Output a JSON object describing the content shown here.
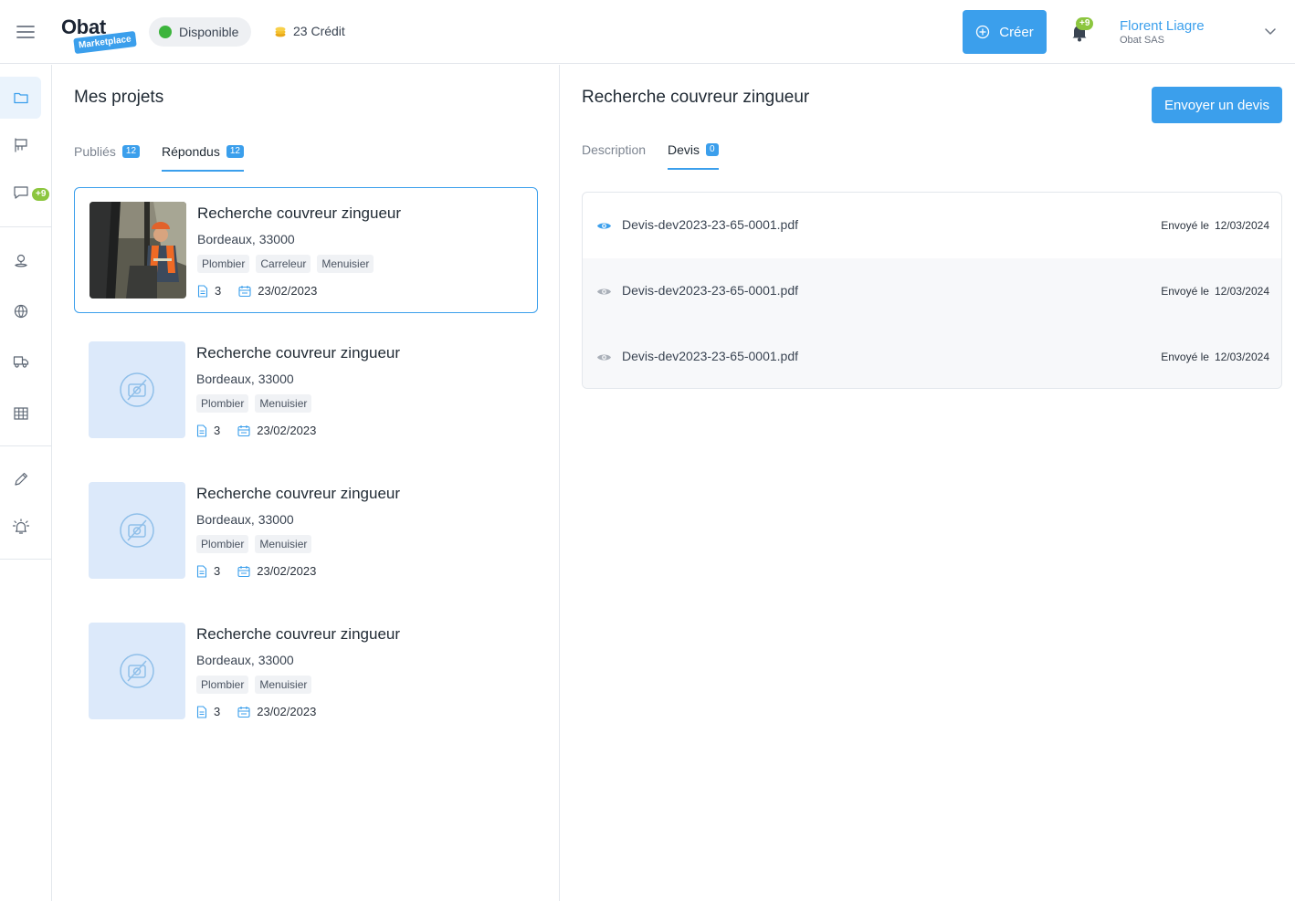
{
  "header": {
    "logo_text": "Obat",
    "logo_badge": "Marketplace",
    "status_label": "Disponible",
    "credit_label": "23 Crédit",
    "create_label": "Créer",
    "notification_badge": "+9",
    "user_name": "Florent Liagre",
    "user_company": "Obat SAS"
  },
  "sidebar": {
    "messages_badge": "+9",
    "items": [
      {
        "icon": "folder-icon"
      },
      {
        "icon": "flag-icon"
      },
      {
        "icon": "chat-icon"
      },
      {
        "icon": "map-pin-icon"
      },
      {
        "icon": "globe-icon"
      },
      {
        "icon": "truck-icon"
      },
      {
        "icon": "grid-table-icon"
      },
      {
        "icon": "pencil-icon"
      },
      {
        "icon": "alarm-bell-icon"
      }
    ]
  },
  "projects": {
    "title": "Mes projets",
    "tabs": [
      {
        "label": "Publiés",
        "count": "12"
      },
      {
        "label": "Répondus",
        "count": "12"
      }
    ],
    "cards": [
      {
        "title": "Recherche couvreur zingueur",
        "location": "Bordeaux, 33000",
        "tags": [
          "Plombier",
          "Carreleur",
          "Menuisier"
        ],
        "documents": "3",
        "date": "23/02/2023"
      },
      {
        "title": "Recherche couvreur zingueur",
        "location": "Bordeaux, 33000",
        "tags": [
          "Plombier",
          "Menuisier"
        ],
        "documents": "3",
        "date": "23/02/2023"
      },
      {
        "title": "Recherche couvreur zingueur",
        "location": "Bordeaux, 33000",
        "tags": [
          "Plombier",
          "Menuisier"
        ],
        "documents": "3",
        "date": "23/02/2023"
      },
      {
        "title": "Recherche couvreur zingueur",
        "location": "Bordeaux, 33000",
        "tags": [
          "Plombier",
          "Menuisier"
        ],
        "documents": "3",
        "date": "23/02/2023"
      }
    ]
  },
  "detail": {
    "title": "Recherche couvreur zingueur",
    "send_button": "Envoyer un devis",
    "tabs": [
      {
        "label": "Description"
      },
      {
        "label": "Devis",
        "count": "0"
      }
    ],
    "files": [
      {
        "name": "Devis-dev2023-23-65-0001.pdf",
        "sent_label": "Envoyé le",
        "sent_date": "12/03/2024"
      },
      {
        "name": "Devis-dev2023-23-65-0001.pdf",
        "sent_label": "Envoyé le",
        "sent_date": "12/03/2024"
      },
      {
        "name": "Devis-dev2023-23-65-0001.pdf",
        "sent_label": "Envoyé le",
        "sent_date": "12/03/2024"
      }
    ]
  },
  "colors": {
    "accent": "#3b9fec",
    "badge_green": "#8cc63f",
    "status_green": "#3cb43c"
  }
}
